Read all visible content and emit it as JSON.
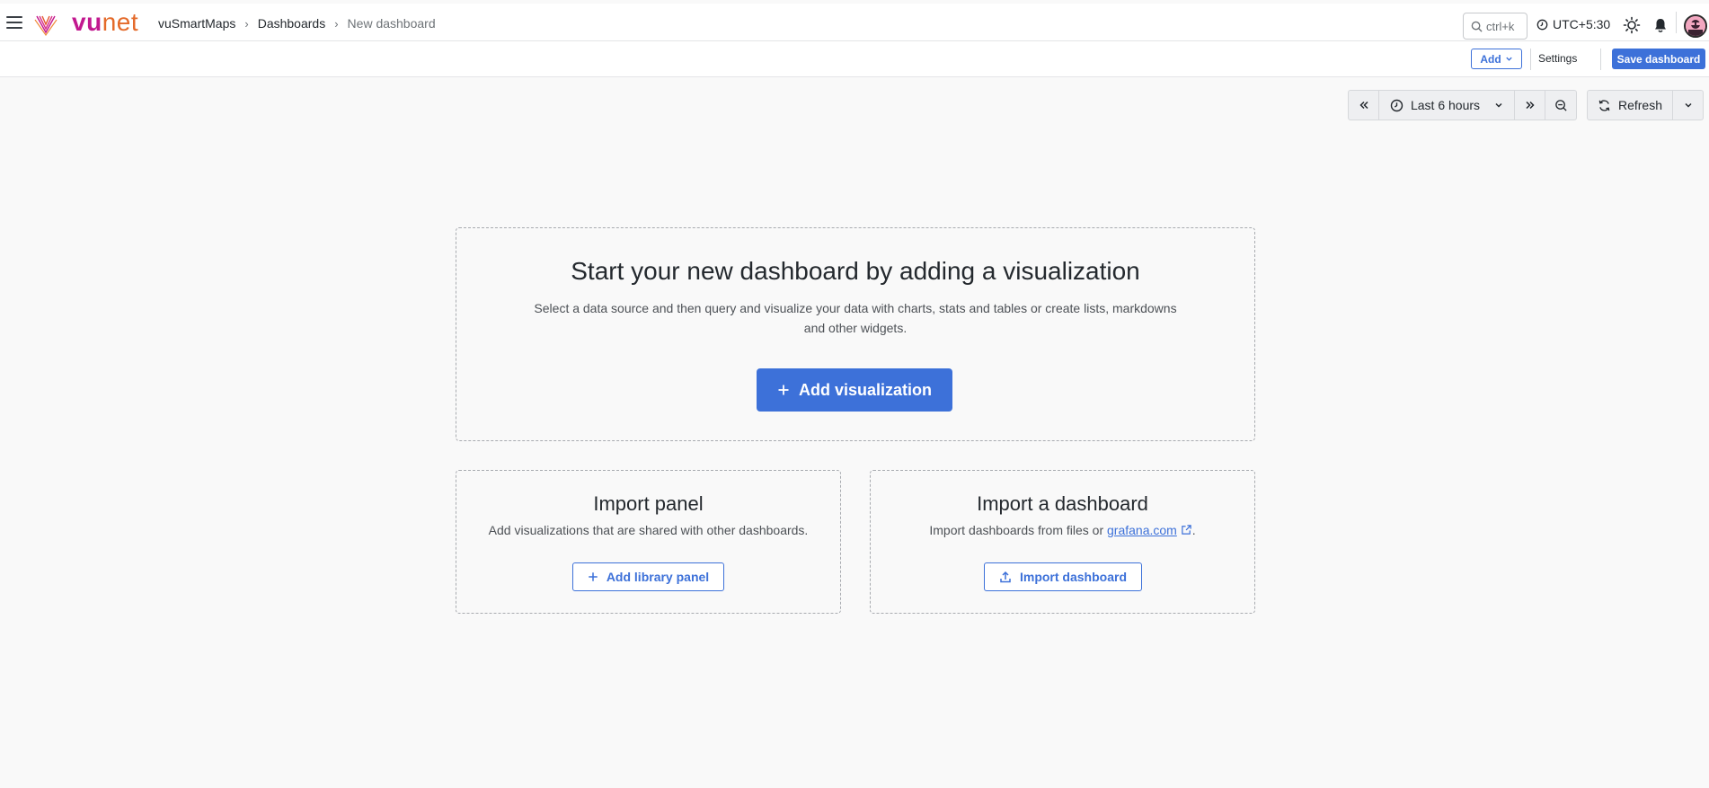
{
  "app": {
    "logo_text_vu": "vu",
    "logo_text_net": "net",
    "brand_color": "#c2188f",
    "accent_color": "#3d71d9"
  },
  "breadcrumb": {
    "items": [
      {
        "label": "vuSmartMaps"
      },
      {
        "label": "Dashboards"
      },
      {
        "label": "New dashboard"
      }
    ]
  },
  "topbar": {
    "search_placeholder": "ctrl+k",
    "timezone": "UTC+5:30",
    "icons": [
      "menu-icon",
      "search-icon",
      "clock-icon",
      "sun-icon",
      "bell-icon",
      "avatar"
    ]
  },
  "toolbar": {
    "add_label": "Add",
    "settings_label": "Settings",
    "save_label": "Save dashboard"
  },
  "timepicker": {
    "range_label": "Last 6 hours",
    "refresh_label": "Refresh"
  },
  "empty_state": {
    "title": "Start your new dashboard by adding a visualization",
    "description_line1": "Select a data source and then query and visualize your data with charts, stats and tables or create lists, markdowns",
    "description_line2": "and other widgets.",
    "button_label": "Add visualization"
  },
  "import_panel": {
    "title": "Import panel",
    "description": "Add visualizations that are shared with other dashboards.",
    "button_label": "Add library panel"
  },
  "import_dashboard": {
    "title": "Import a dashboard",
    "description_prefix": "Import dashboards from files or",
    "link_label": "grafana.com",
    "description_suffix": ".",
    "button_label": "Import dashboard"
  }
}
